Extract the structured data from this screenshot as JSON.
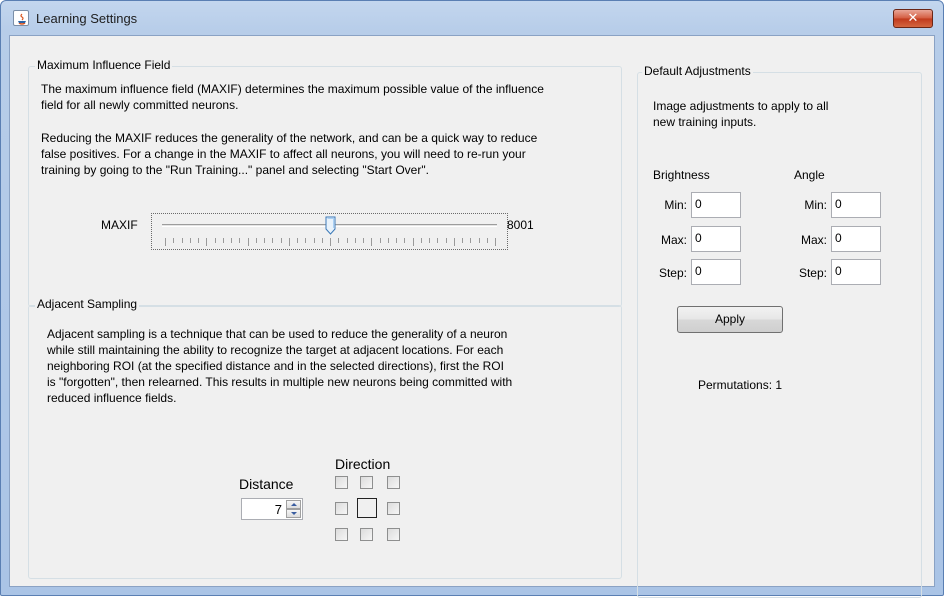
{
  "window": {
    "title": "Learning Settings",
    "close_label": "✕"
  },
  "max_influence": {
    "group_title": "Maximum Influence Field",
    "para1_line1": "The maximum influence field (MAXIF) determines the maximum possible value of the influence",
    "para1_line2": "field for all newly committed neurons.",
    "para2_line1": "Reducing the MAXIF reduces the generality of the network, and can be a quick way to reduce",
    "para2_line2": "false positives. For a change in the MAXIF to affect all neurons, you will need to re-run your",
    "para2_line3": "training by going to the \"Run Training...\" panel and selecting \"Start Over\".",
    "slider_label": "MAXIF",
    "slider_value": "8001",
    "slider_fraction": 0.5
  },
  "adjacent_sampling": {
    "group_title": "Adjacent Sampling",
    "line1": "Adjacent sampling is a technique that can be used to reduce the generality of a neuron",
    "line2": "while still maintaining the ability to recognize the target at adjacent locations. For each",
    "line3": "neighboring ROI (at the specified distance and in the selected directions), first the ROI",
    "line4": "is \"forgotten\", then relearned. This results in multiple new neurons being committed with",
    "line5": "reduced influence fields.",
    "distance_label": "Distance",
    "distance_value": "7",
    "direction_label": "Direction"
  },
  "default_adjustments": {
    "group_title": "Default Adjustments",
    "desc_line1": "Image adjustments to apply to all",
    "desc_line2": "new training inputs.",
    "brightness_label": "Brightness",
    "angle_label": "Angle",
    "min_label": "Min:",
    "max_label": "Max:",
    "step_label": "Step:",
    "brightness_min": "0",
    "brightness_max": "0",
    "brightness_step": "0",
    "angle_min": "0",
    "angle_max": "0",
    "angle_step": "0",
    "apply_label": "Apply",
    "permutations_text": "Permutations: 1"
  }
}
